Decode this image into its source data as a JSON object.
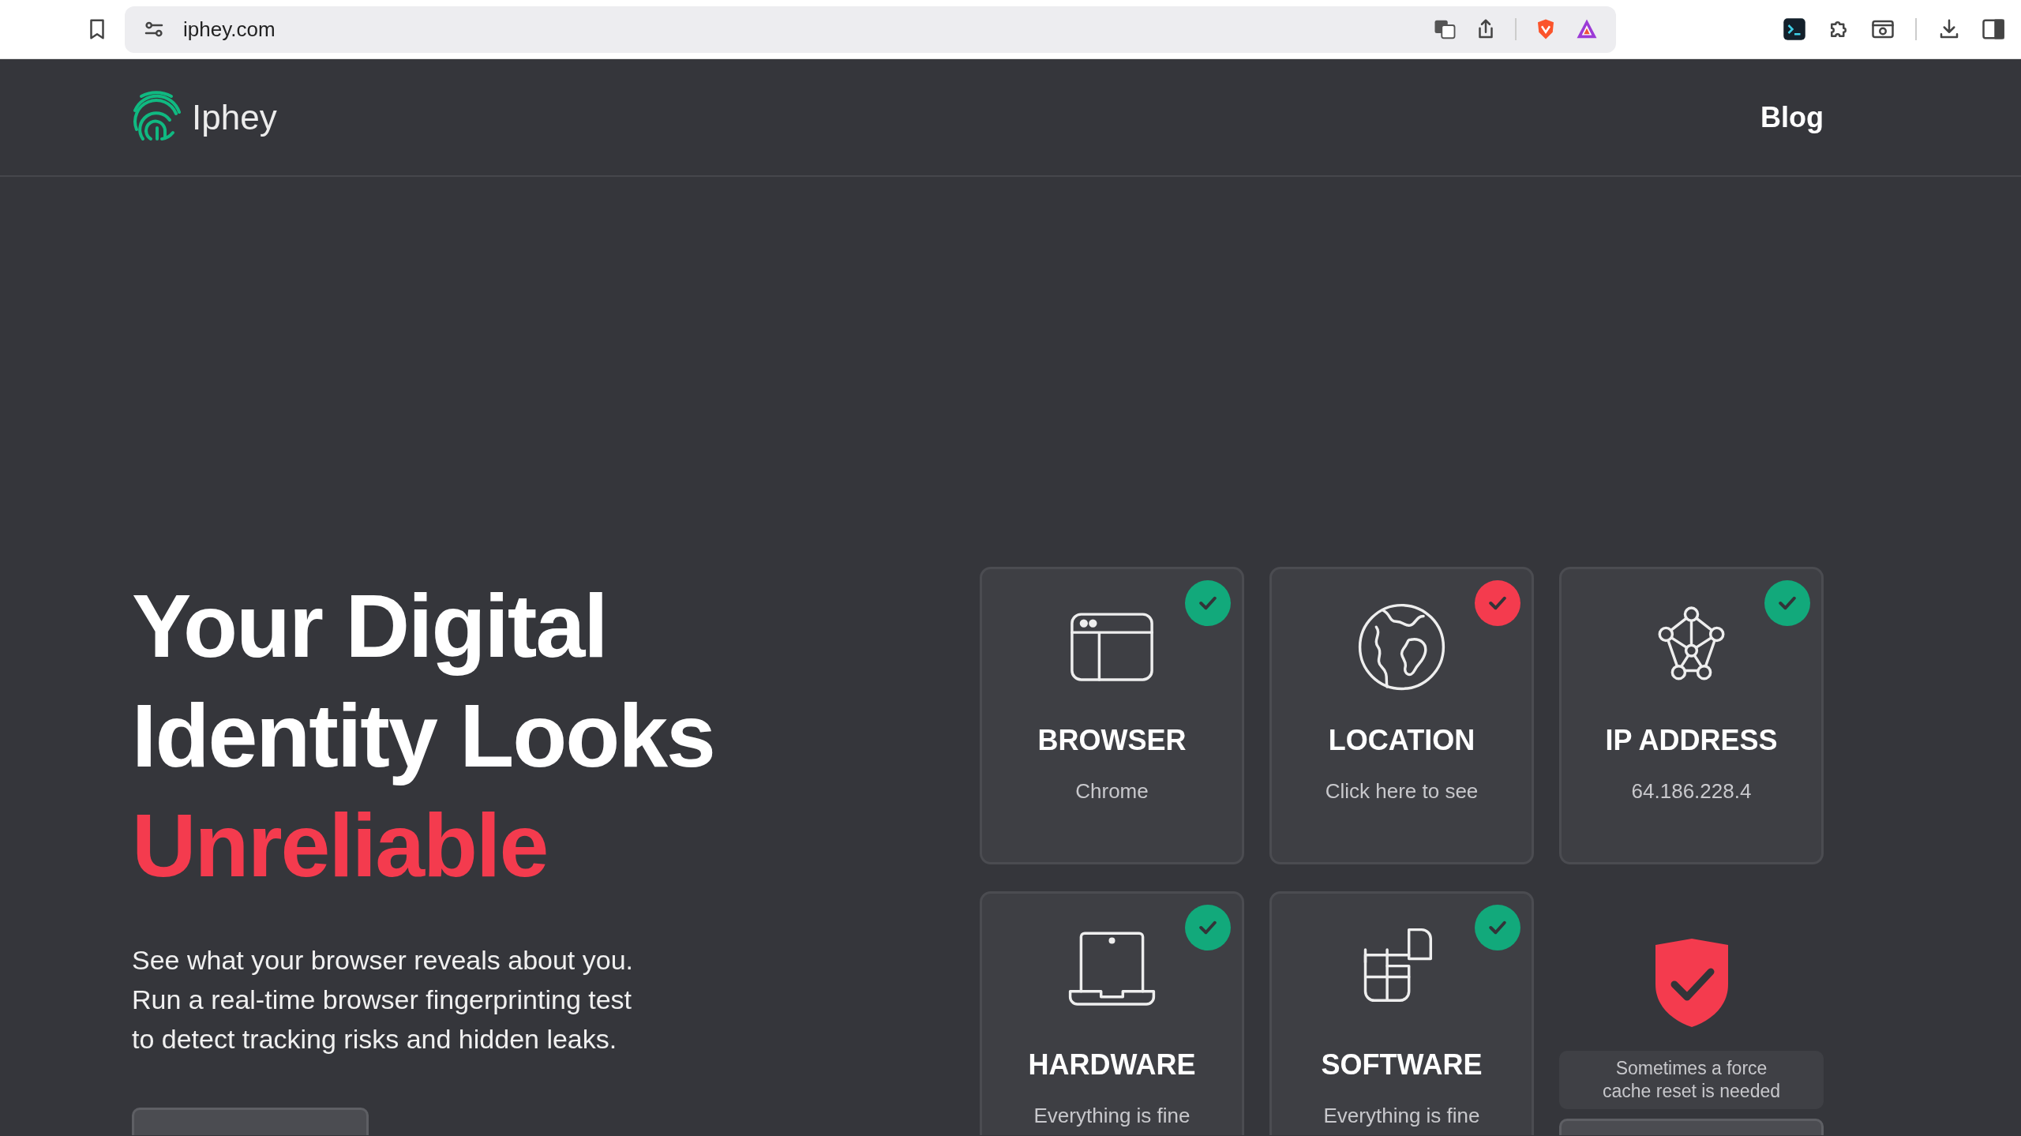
{
  "browser": {
    "url": "iphey.com"
  },
  "header": {
    "logo": "Iphey",
    "nav": [
      "Blog"
    ]
  },
  "hero": {
    "title_lines": [
      "Your Digital",
      "Identity Looks"
    ],
    "highlight": "Unreliable",
    "description_lines": [
      "See what your browser reveals about you.",
      "Run a real-time browser fingerprinting test",
      "to detect tracking risks and hidden leaks."
    ]
  },
  "cards": [
    {
      "kind": "browser",
      "title": "BROWSER",
      "value": "Chrome",
      "color": "#12a97b"
    },
    {
      "kind": "location",
      "title": "LOCATION",
      "value": "Click here to see",
      "color": "#f43b4e"
    },
    {
      "kind": "ip",
      "title": "IP ADDRESS",
      "value": "64.186.228.4",
      "color": "#12a97b"
    },
    {
      "kind": "hardware",
      "title": "HARDWARE",
      "value": "Everything is fine",
      "color": "#12a97b"
    },
    {
      "kind": "software",
      "title": "SOFTWARE",
      "value": "Everything is fine",
      "color": "#12a97b"
    }
  ],
  "cache_note": "Sometimes a force cache reset is needed"
}
